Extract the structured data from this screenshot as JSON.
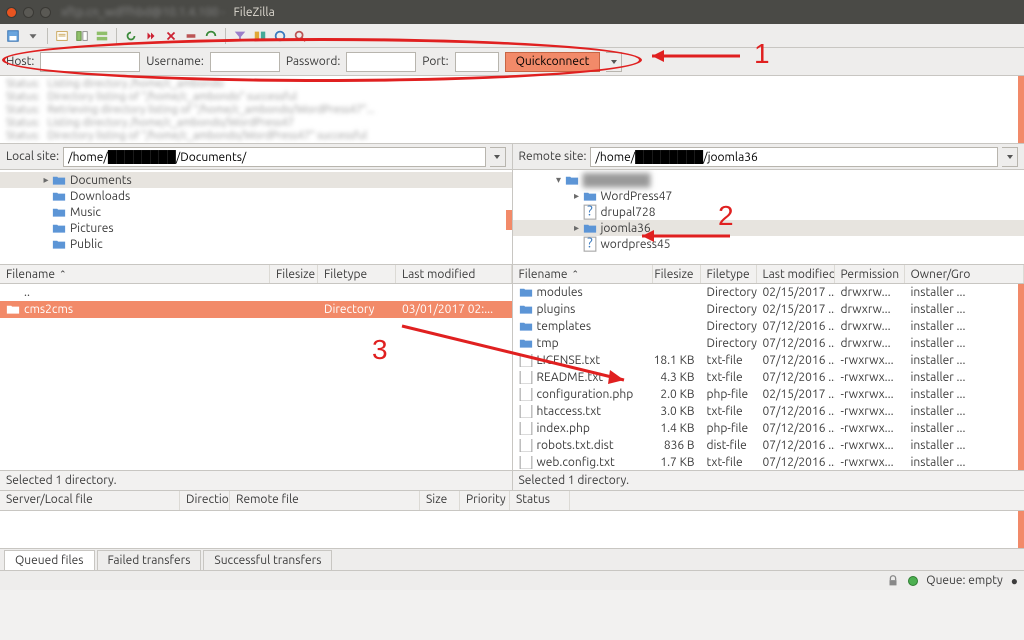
{
  "titlebar": {
    "app": "FileZilla",
    "prefix_blur": "xftp.cn_wdffhbd@10.1.4.100 - "
  },
  "quickconnect": {
    "host_label": "Host:",
    "user_label": "Username:",
    "pass_label": "Password:",
    "port_label": "Port:",
    "button": "Quickconnect"
  },
  "local": {
    "label": "Local site:",
    "path": "/home/████████/Documents/",
    "tree": [
      "Documents",
      "Downloads",
      "Music",
      "Pictures",
      "Public"
    ],
    "headers": {
      "name": "Filename",
      "size": "Filesize",
      "type": "Filetype",
      "mod": "Last modified"
    },
    "rows": [
      {
        "name": "..",
        "size": "",
        "type": "",
        "mod": "",
        "icon": "up"
      },
      {
        "name": "cms2cms",
        "size": "",
        "type": "Directory",
        "mod": "03/01/2017 02:...",
        "icon": "folder",
        "selected": true
      }
    ],
    "status": "Selected 1 directory."
  },
  "remote": {
    "label": "Remote site:",
    "path": "/home/████████/joomla36",
    "tree": [
      {
        "name": "████████",
        "depth": 0,
        "expander": "▾",
        "icon": "folder",
        "blur": true
      },
      {
        "name": "WordPress47",
        "depth": 1,
        "expander": "▸",
        "icon": "folder"
      },
      {
        "name": "drupal728",
        "depth": 1,
        "expander": "",
        "icon": "unknown"
      },
      {
        "name": "joomla36",
        "depth": 1,
        "expander": "▸",
        "icon": "folder",
        "selected": true
      },
      {
        "name": "wordpress45",
        "depth": 1,
        "expander": "",
        "icon": "unknown"
      }
    ],
    "headers": {
      "name": "Filename",
      "size": "Filesize",
      "type": "Filetype",
      "mod": "Last modified",
      "perm": "Permission",
      "own": "Owner/Gro"
    },
    "rows": [
      {
        "name": "modules",
        "size": "",
        "type": "Directory",
        "mod": "02/15/2017 ...",
        "perm": "drwxrw...",
        "own": "installer ...",
        "icon": "folder"
      },
      {
        "name": "plugins",
        "size": "",
        "type": "Directory",
        "mod": "02/15/2017 ...",
        "perm": "drwxrw...",
        "own": "installer ...",
        "icon": "folder"
      },
      {
        "name": "templates",
        "size": "",
        "type": "Directory",
        "mod": "07/12/2016 ...",
        "perm": "drwxrw...",
        "own": "installer ...",
        "icon": "folder"
      },
      {
        "name": "tmp",
        "size": "",
        "type": "Directory",
        "mod": "07/12/2016 ...",
        "perm": "drwxrw...",
        "own": "installer ...",
        "icon": "folder"
      },
      {
        "name": "LICENSE.txt",
        "size": "18.1 KB",
        "type": "txt-file",
        "mod": "07/12/2016 ...",
        "perm": "-rwxrwx...",
        "own": "installer ...",
        "icon": "file"
      },
      {
        "name": "README.txt",
        "size": "4.3 KB",
        "type": "txt-file",
        "mod": "07/12/2016 ...",
        "perm": "-rwxrwx...",
        "own": "installer ...",
        "icon": "file"
      },
      {
        "name": "configuration.php",
        "size": "2.0 KB",
        "type": "php-file",
        "mod": "02/15/2017 ...",
        "perm": "-rwxrwx...",
        "own": "installer ...",
        "icon": "file"
      },
      {
        "name": "htaccess.txt",
        "size": "3.0 KB",
        "type": "txt-file",
        "mod": "07/12/2016 ...",
        "perm": "-rwxrwx...",
        "own": "installer ...",
        "icon": "file"
      },
      {
        "name": "index.php",
        "size": "1.4 KB",
        "type": "php-file",
        "mod": "07/12/2016 ...",
        "perm": "-rwxrwx...",
        "own": "installer ...",
        "icon": "file"
      },
      {
        "name": "robots.txt.dist",
        "size": "836 B",
        "type": "dist-file",
        "mod": "07/12/2016 ...",
        "perm": "-rwxrwx...",
        "own": "installer ...",
        "icon": "file"
      },
      {
        "name": "web.config.txt",
        "size": "1.7 KB",
        "type": "txt-file",
        "mod": "07/12/2016 ...",
        "perm": "-rwxrwx...",
        "own": "installer ...",
        "icon": "file"
      }
    ],
    "status": "Selected 1 directory."
  },
  "queue": {
    "headers": [
      "Server/Local file",
      "Directio",
      "Remote file",
      "Size",
      "Priority",
      "Status"
    ]
  },
  "tabs": [
    "Queued files",
    "Failed transfers",
    "Successful transfers"
  ],
  "footer": {
    "queue": "Queue: empty"
  },
  "annotations": {
    "n1": "1",
    "n2": "2",
    "n3": "3"
  },
  "local_cols": {
    "name": 270,
    "size": 48,
    "type": 78,
    "mod": 110
  },
  "remote_cols": {
    "name": 140,
    "size": 48,
    "type": 56,
    "mod": 78,
    "perm": 70,
    "own": 66
  }
}
